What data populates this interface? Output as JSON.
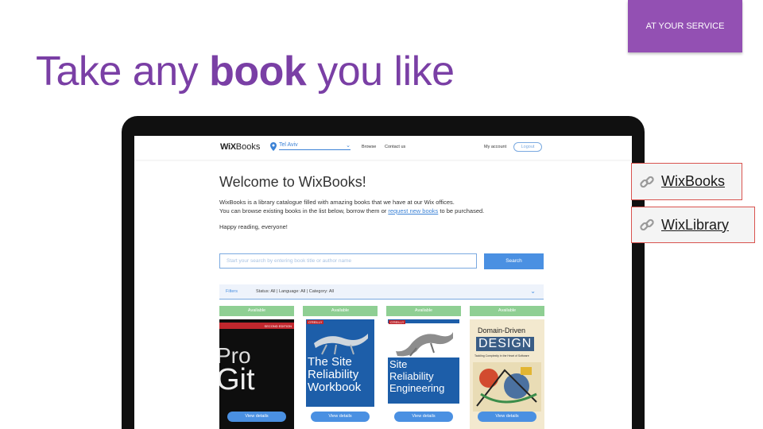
{
  "slide": {
    "tag": "AT YOUR SERVICE",
    "title_pre": "Take any ",
    "title_bold": "book",
    "title_post": " you like"
  },
  "links": [
    {
      "label": "WixBooks",
      "icon": "link-icon"
    },
    {
      "label": "WixLibrary",
      "icon": "link-icon"
    }
  ],
  "site": {
    "logo_bold": "WiX",
    "logo_rest": "Books",
    "location": "Tel Aviv",
    "nav": {
      "browse": "Browse",
      "contact": "Contact us",
      "account": "My account",
      "logout": "Logout"
    },
    "welcome": "Welcome to WixBooks!",
    "intro_line1": "WixBooks is a library catalogue filled with amazing books that we have at our Wix offices.",
    "intro_line2_pre": "You can browse existing books in the list below, borrow them or ",
    "intro_link": "request new books",
    "intro_line2_post": " to be purchased.",
    "happy": "Happy reading, everyone!",
    "search": {
      "placeholder": "Start your search by entering book title or author name",
      "button": "Search"
    },
    "filters": {
      "label": "Filters",
      "summary": "Status: All | Language: All | Category: All"
    },
    "books": [
      {
        "status": "Available",
        "cover_line1": "Pro",
        "cover_line2": "Git",
        "badge": "SECOND EDITION",
        "details": "View details"
      },
      {
        "status": "Available",
        "publisher": "O'REILLY",
        "cover_line1": "The Site",
        "cover_line2": "Reliability",
        "cover_line3": "Workbook",
        "details": "View details"
      },
      {
        "status": "Available",
        "publisher": "O'REILLY",
        "cover_line1": "Site",
        "cover_line2": "Reliability",
        "cover_line3": "Engineering",
        "details": "View details"
      },
      {
        "status": "Available",
        "cover_line1": "Domain-Driven",
        "cover_line2": "DESIGN",
        "cover_line3": "Tackling Complexity in the Heart of Software",
        "details": "View details"
      }
    ]
  },
  "colors": {
    "accent": "#7a3fa5",
    "tag": "#9350b3",
    "link_blue": "#4a90e2",
    "available_green": "#8fcf93"
  }
}
